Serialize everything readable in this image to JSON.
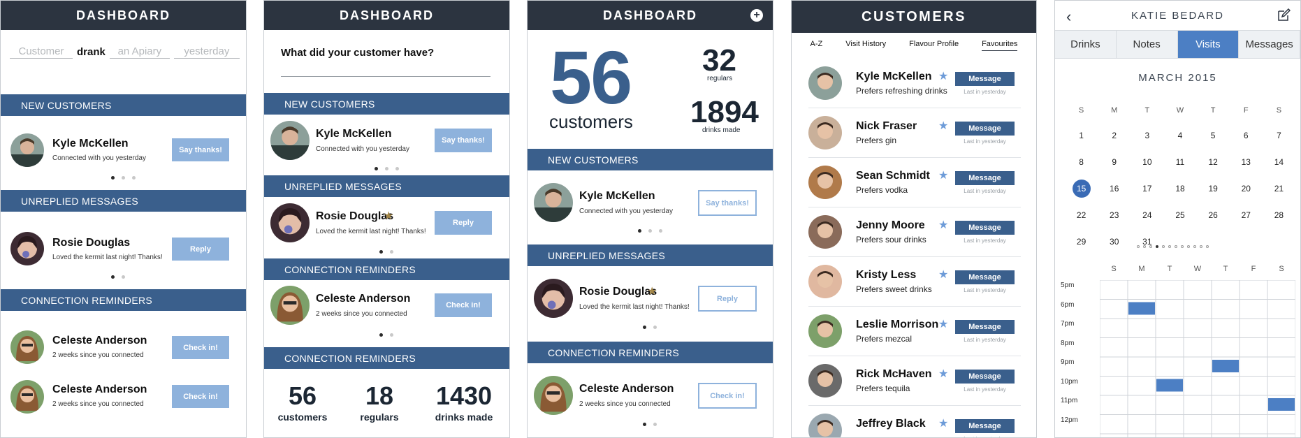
{
  "screen1": {
    "title": "DASHBOARD",
    "sentence": {
      "customer_ph": "Customer",
      "verb": "drank",
      "product_ph": "an Apiary",
      "time_ph": "yesterday"
    },
    "new_customers_heading": "NEW CUSTOMERS",
    "new_customer": {
      "name": "Kyle McKellen",
      "sub": "Connected with you yesterday",
      "action": "Say thanks!"
    },
    "unreplied_heading": "UNREPLIED MESSAGES",
    "unreplied": {
      "name": "Rosie Douglas",
      "sub": "Loved the kermit last night! Thanks!",
      "action": "Reply"
    },
    "reminders_heading": "CONNECTION REMINDERS",
    "reminders": [
      {
        "name": "Celeste Anderson",
        "sub": "2 weeks since you connected",
        "action": "Check in!"
      },
      {
        "name": "Celeste Anderson",
        "sub": "2 weeks since you connected",
        "action": "Check in!"
      }
    ]
  },
  "screen2": {
    "title": "DASHBOARD",
    "question": "What did your customer have?",
    "new_customers_heading": "NEW CUSTOMERS",
    "new_customer": {
      "name": "Kyle McKellen",
      "sub": "Connected with you yesterday",
      "action": "Say thanks!"
    },
    "unreplied_heading": "UNREPLIED MESSAGES",
    "unreplied": {
      "name": "Rosie Douglas",
      "sub": "Loved the kermit last night! Thanks!",
      "action": "Reply"
    },
    "reminders_heading": "CONNECTION REMINDERS",
    "reminder": {
      "name": "Celeste Anderson",
      "sub": "2 weeks since you connected",
      "action": "Check in!"
    },
    "reminders_heading_2": "CONNECTION REMINDERS",
    "stats": [
      {
        "value": "56",
        "label": "customers"
      },
      {
        "value": "18",
        "label": "regulars"
      },
      {
        "value": "1430",
        "label": "drinks made"
      }
    ]
  },
  "screen3": {
    "title": "DASHBOARD",
    "customers_count": "56",
    "customers_label": "customers",
    "regulars_count": "32",
    "regulars_label": "regulars",
    "drinks_count": "1894",
    "drinks_label": "drinks made",
    "new_customers_heading": "NEW CUSTOMERS",
    "new_customer": {
      "name": "Kyle McKellen",
      "sub": "Connected with you yesterday",
      "action": "Say thanks!"
    },
    "unreplied_heading": "UNREPLIED MESSAGES",
    "unreplied": {
      "name": "Rosie Douglas",
      "sub": "Loved the kermit last night! Thanks!",
      "action": "Reply"
    },
    "reminders_heading": "CONNECTION REMINDERS",
    "reminder": {
      "name": "Celeste Anderson",
      "sub": "2 weeks since you connected",
      "action": "Check in!"
    }
  },
  "screen4": {
    "title": "CUSTOMERS",
    "tabs": [
      "A-Z",
      "Visit History",
      "Flavour Profile",
      "Favourites"
    ],
    "selected_tab": "Favourites",
    "message_label": "Message",
    "last_label": "Last in yesterday",
    "customers": [
      {
        "name": "Kyle McKellen",
        "pref": "Prefers refreshing drinks"
      },
      {
        "name": "Nick Fraser",
        "pref": "Prefers gin"
      },
      {
        "name": "Sean Schmidt",
        "pref": "Prefers vodka"
      },
      {
        "name": "Jenny Moore",
        "pref": "Prefers sour drinks"
      },
      {
        "name": "Kristy Less",
        "pref": "Prefers sweet drinks"
      },
      {
        "name": "Leslie Morrison",
        "pref": "Prefers mezcal"
      },
      {
        "name": "Rick McHaven",
        "pref": "Prefers tequila"
      },
      {
        "name": "Jeffrey Black",
        "pref": ""
      }
    ]
  },
  "screen5": {
    "title": "KATIE BEDARD",
    "tabs": [
      "Drinks",
      "Notes",
      "Visits",
      "Messages"
    ],
    "selected_tab": "Visits",
    "month": "MARCH 2015",
    "weekdays": [
      "S",
      "M",
      "T",
      "W",
      "T",
      "F",
      "S"
    ],
    "weeks": [
      [
        "1",
        "2",
        "3",
        "4",
        "5",
        "6",
        "7"
      ],
      [
        "8",
        "9",
        "10",
        "11",
        "12",
        "13",
        "14"
      ],
      [
        "15",
        "16",
        "17",
        "18",
        "19",
        "20",
        "21"
      ],
      [
        "22",
        "23",
        "24",
        "25",
        "26",
        "27",
        "28"
      ],
      [
        "29",
        "30",
        "31",
        "",
        "",
        "",
        ""
      ]
    ],
    "today": "15",
    "hours": [
      "5pm",
      "6pm",
      "7pm",
      "8pm",
      "9pm",
      "10pm",
      "11pm",
      "12pm"
    ],
    "visits": [
      {
        "day": "M",
        "hour": "6pm"
      },
      {
        "day": "T",
        "hour": "9pm"
      },
      {
        "day": "T",
        "hour": "10pm"
      },
      {
        "day": "S",
        "hour": "11pm"
      }
    ]
  },
  "colors": {
    "navy": "#2c3440",
    "band": "#3a5f8c",
    "button": "#8eb2dc",
    "accent": "#4c7fc4",
    "star_gold": "#a48748",
    "star_blue": "#6d9bd8"
  }
}
